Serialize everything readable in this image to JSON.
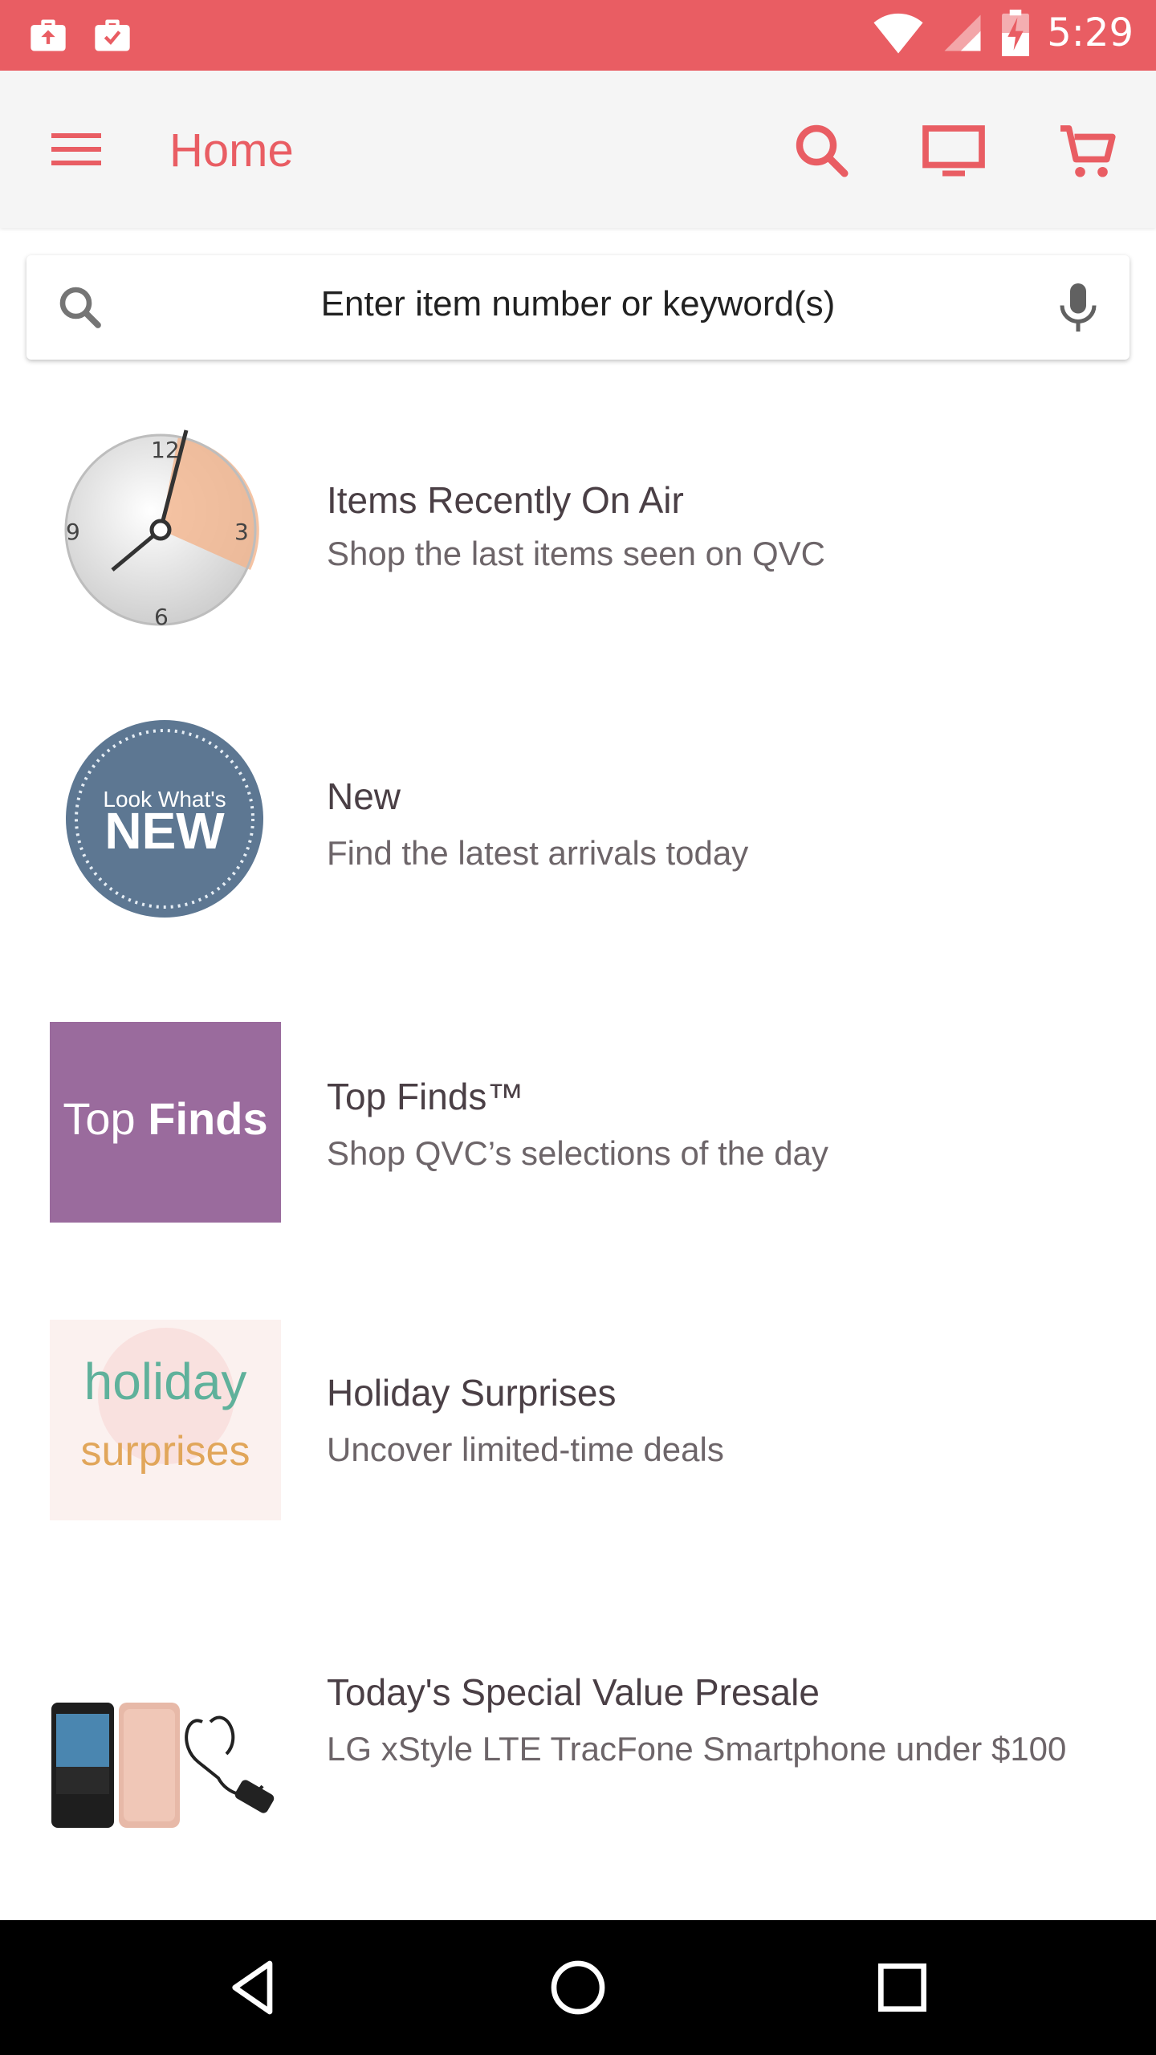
{
  "status_bar": {
    "time": "5:29",
    "left_icons": [
      "briefcase-upload-icon",
      "briefcase-check-icon"
    ],
    "right_icons": [
      "wifi-icon",
      "cell-signal-icon",
      "battery-charging-icon"
    ],
    "color": "#e95d63"
  },
  "app_bar": {
    "title": "Home",
    "actions": [
      "search-icon",
      "tv-icon",
      "cart-icon"
    ],
    "accent": "#e95d63"
  },
  "search": {
    "placeholder": "Enter item number or keyword(s)"
  },
  "list": {
    "items": [
      {
        "title": "Items Recently On Air",
        "subtitle": "Shop the last items seen on QVC",
        "thumb": "clock-image"
      },
      {
        "title": "New",
        "subtitle": "Find the latest arrivals today",
        "thumb": "look-whats-new-badge",
        "badge_top": "Look What's",
        "badge_main": "NEW"
      },
      {
        "title": "Top Finds™",
        "subtitle": "Shop QVC’s selections of the day",
        "thumb": "top-finds-logo",
        "logo_text_a": "Top",
        "logo_text_b": "Finds"
      },
      {
        "title": "Holiday Surprises",
        "subtitle": "Uncover limited-time deals",
        "thumb": "holiday-surprises-image",
        "logo_text_a": "holiday",
        "logo_text_b": "surprises"
      },
      {
        "title": "Today's Special Value Presale",
        "subtitle": "LG xStyle LTE TracFone Smartphone under $100",
        "thumb": "smartphone-bundle-image"
      }
    ]
  },
  "clock_labels": {
    "twelve": "12",
    "three": "3",
    "six": "6",
    "nine": "9"
  },
  "nav_bar": {
    "buttons": [
      "back-icon",
      "home-icon",
      "recents-icon"
    ]
  }
}
